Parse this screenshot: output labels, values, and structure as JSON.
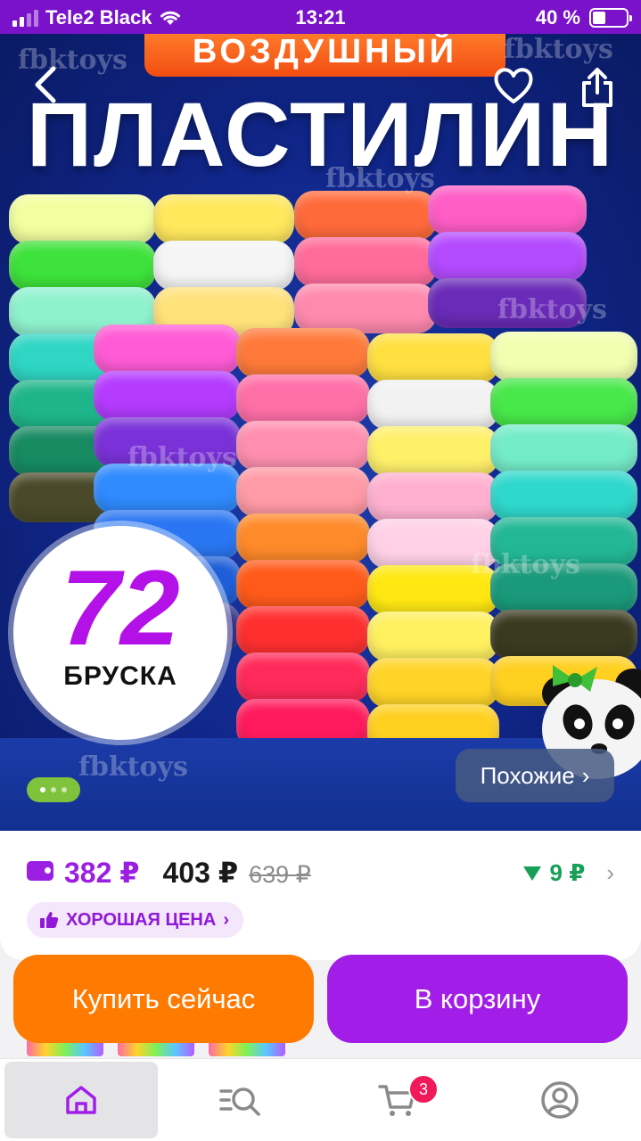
{
  "status_bar": {
    "carrier": "Tele2 Black",
    "time": "13:21",
    "battery": "40 %",
    "battery_level": 0.4
  },
  "hero": {
    "banner": "ВОЗДУШНЫЙ",
    "title": "ПЛАСТИЛИН",
    "watermark": "fbktoys",
    "badge_number": "72",
    "badge_label": "БРУСКА",
    "similar_label": "Похожие",
    "carousel_index": 1,
    "carousel_count": 3
  },
  "price": {
    "wallet_price": "382 ₽",
    "current_price": "403 ₽",
    "old_price": "639 ₽",
    "price_drop": "9 ₽",
    "good_price_label": "ХОРОШАЯ ЦЕНА"
  },
  "actions": {
    "buy_now": "Купить сейчас",
    "add_to_cart": "В корзину"
  },
  "tabbar": {
    "cart_count": "3",
    "tabs": [
      {
        "icon": "home-icon",
        "active": true
      },
      {
        "icon": "catalog-search-icon",
        "active": false
      },
      {
        "icon": "cart-icon",
        "active": false
      },
      {
        "icon": "profile-icon",
        "active": false
      }
    ]
  },
  "colors": {
    "brand_purple": "#a21ee8",
    "buy_orange": "#ff7a00",
    "price_drop_green": "#18a058",
    "badge_pink": "#f0195a"
  }
}
